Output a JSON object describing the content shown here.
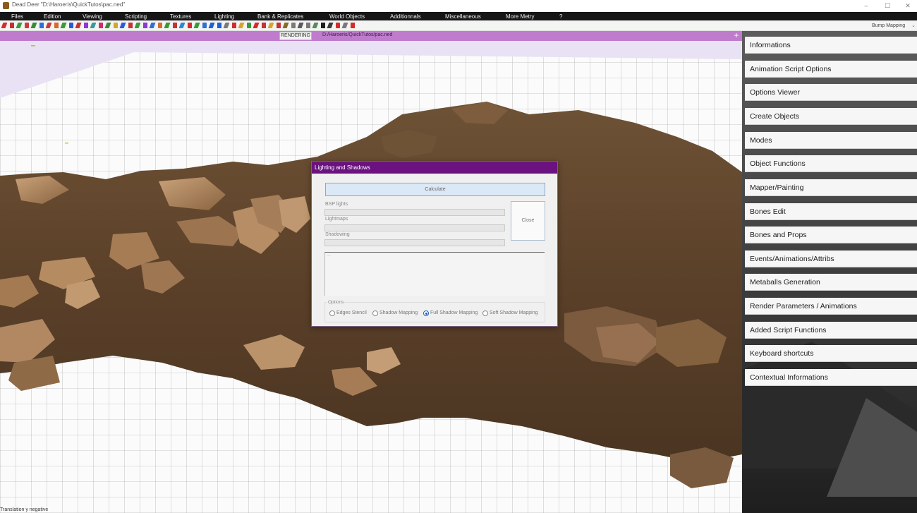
{
  "window": {
    "title": "Dead Deer \"D:\\Haroeris\\QuickTutos\\pac.ned\"",
    "minimize": "–",
    "maximize": "☐",
    "close": "✕"
  },
  "menu": [
    "Files",
    "Edition",
    "Viewing",
    "Scripting",
    "Textures",
    "Lighting",
    "Bank & Replicates",
    "World Objects",
    "Additionnals",
    "Miscellaneous",
    "More Metry",
    "?"
  ],
  "toolbar": {
    "mode_select": "Bump Mapping",
    "icon_colors": [
      "#d62b2b",
      "#c62f2f",
      "#3b9a3b",
      "#cf3b3b",
      "#3a8a3a",
      "#2f6fd6",
      "#c83a3a",
      "#d66b2a",
      "#3a9a3a",
      "#2a5ad6",
      "#c73232",
      "#8a3ad6",
      "#3a9a9a",
      "#d62b6b",
      "#3a8a3a",
      "#d6a62b",
      "#2a5ad6",
      "#c73232",
      "#3a9a3a",
      "#8a3ad6",
      "#2f6fd6",
      "#d66b2a",
      "#3a9a3a",
      "#c73232",
      "#2a8ad6",
      "#d62b2b",
      "#3a9a3a",
      "#2f6fd6",
      "#1e5fd6",
      "#1e5fd6",
      "#7a7a7a",
      "#d62b2b",
      "#d6a62b",
      "#3a9a3a",
      "#d62b2b",
      "#c73232",
      "#d6a62b",
      "#c73232",
      "#8a6a2a",
      "#7a7a7a",
      "#5a5a5a",
      "#7a7a7a",
      "#5a8a5a",
      "#1e1e1e",
      "#3a3a3a",
      "#d62b2b",
      "#7a7a7a",
      "#d62b2b"
    ]
  },
  "viewport": {
    "rendering_tab": "RENDERING",
    "file_path": "D:/Haroeris/QuickTutos/pac.ned",
    "plus": "+",
    "status": "Translation y negative"
  },
  "right_panel": {
    "buttons": [
      "Informations",
      "Animation Script Options",
      "Options Viewer",
      "Create Objects",
      "Modes",
      "Object Functions",
      "Mapper/Painting",
      "Bones Edit",
      "Bones and Props",
      "Events/Animations/Attribs",
      "Metaballs Generation",
      "Render Parameters / Animations",
      "Added Script Functions",
      "Keyboard shortcuts",
      "Contextual Informations"
    ]
  },
  "dialog": {
    "title": "Lighting and Shadows",
    "calculate": "Calculate",
    "close": "Close",
    "bsp_lights_label": "BSP lights",
    "bsp_lights_progress": 0,
    "lightmaps_label": "Lightmaps",
    "lightmaps_progress": 0,
    "shadowing_label": "Shadowing",
    "shadowing_progress": 0,
    "log_text": "...",
    "options_label": "Options",
    "options": [
      {
        "label": "Edges Stencil",
        "checked": false
      },
      {
        "label": "Shadow Mapping",
        "checked": false
      },
      {
        "label": "Full Shadow Mapping",
        "checked": true
      },
      {
        "label": "Soft Shadow Mapping",
        "checked": false
      }
    ]
  }
}
